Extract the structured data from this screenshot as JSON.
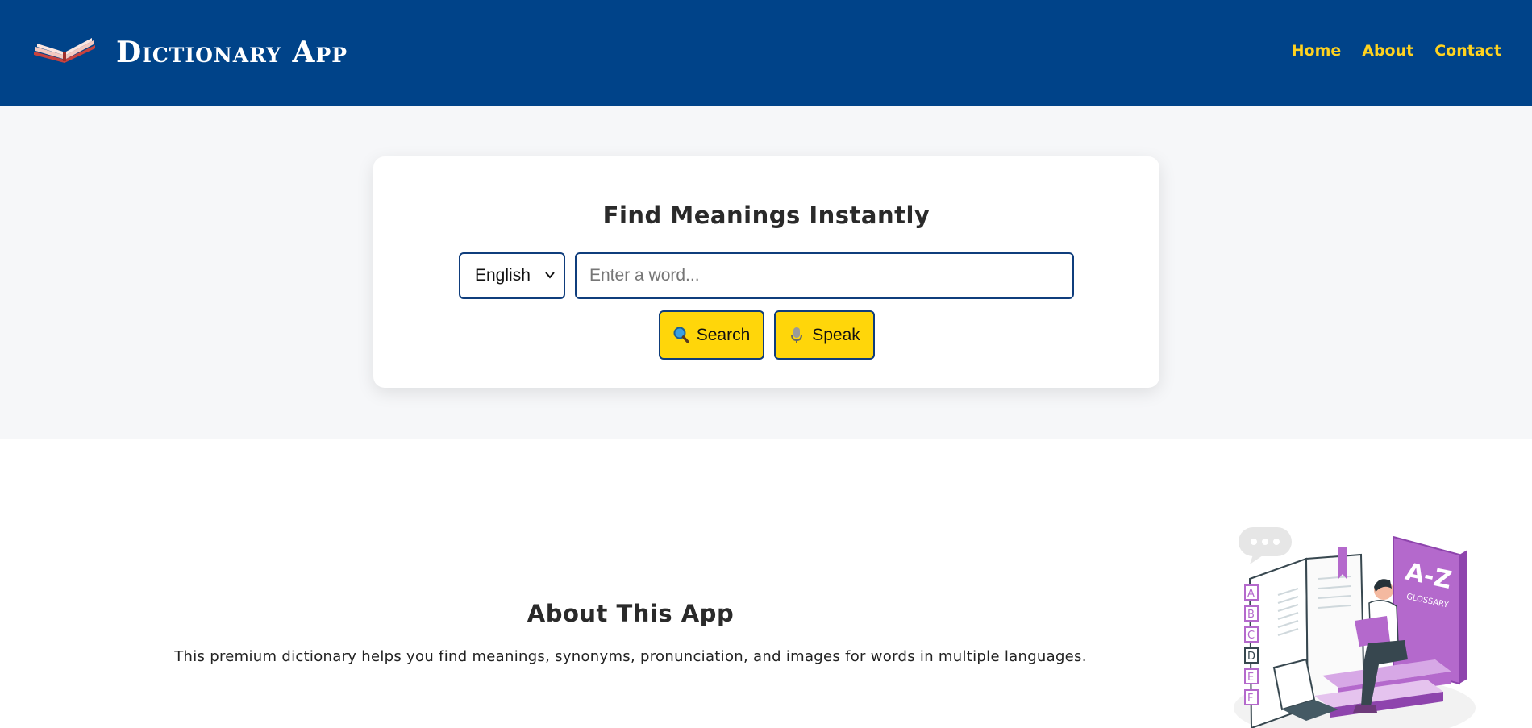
{
  "header": {
    "brand": "Dictionary App",
    "nav": [
      "Home",
      "About",
      "Contact"
    ]
  },
  "search": {
    "title": "Find Meanings Instantly",
    "language_selected": "English",
    "placeholder": "Enter a word...",
    "value": "",
    "search_label": "Search",
    "speak_label": "Speak"
  },
  "about": {
    "title": "About This App",
    "text": "This premium dictionary helps you find meanings, synonyms, pronunciation, and images for words in multiple languages.",
    "illustration_letters": [
      "A",
      "B",
      "C",
      "D",
      "E",
      "F"
    ],
    "illustration_book_title": "A-Z",
    "illustration_book_subtitle": "GLOSSARY"
  },
  "colors": {
    "header_bg": "#004389",
    "nav_link": "#ffd21f",
    "button_bg": "#ffd60a",
    "border": "#0f3d7c",
    "accent_purple": "#b469cc"
  },
  "icons": {
    "logo": "open-book-icon",
    "search_button": "magnifier-icon",
    "speak_button": "microphone-icon",
    "select": "chevron-down-icon"
  }
}
